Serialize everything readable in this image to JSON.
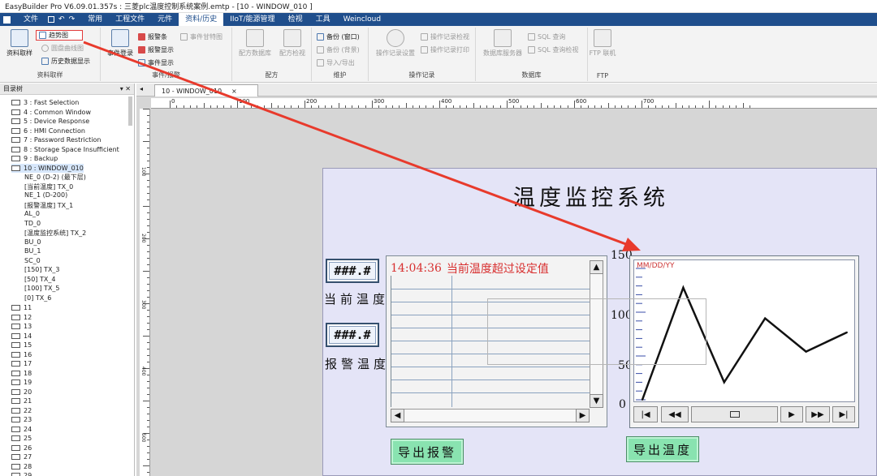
{
  "app": {
    "title": "EasyBuilder Pro V6.09.01.357s : 三菱plc温度控制系统案例.emtp - [10 - WINDOW_010 ]"
  },
  "menubar": {
    "items": [
      {
        "label": "文件"
      },
      {
        "label": "常用"
      },
      {
        "label": "工程文件"
      },
      {
        "label": "元件"
      },
      {
        "label": "资料/历史"
      },
      {
        "label": "IIoT/能源管理"
      },
      {
        "label": "检视"
      },
      {
        "label": "工具"
      },
      {
        "label": "Weincloud"
      }
    ],
    "active_index": 4
  },
  "ribbon": {
    "sample": {
      "big_label": "资料取样",
      "trend": "趋势图",
      "circle_trend": "圆盘曲线图",
      "history": "历史数据显示",
      "group": "资料取样"
    },
    "event": {
      "big_label": "事件登录",
      "alarm_bar": "报警条",
      "alarm_display": "报警显示",
      "event_display": "事件显示",
      "gantt": "事件甘特图",
      "group": "事件/报警"
    },
    "recipe": {
      "db": "配方数据库",
      "view": "配方检视",
      "group": "配方"
    },
    "maint": {
      "backup_win": "备份 (窗口)",
      "backup_bg": "备份 (背景)",
      "import_export": "导入/导出",
      "group": "维护"
    },
    "oplog": {
      "settings": "操作记录设置",
      "view": "操作记录检视",
      "print": "操作记录打印",
      "group": "操作记录"
    },
    "database": {
      "server": "数据库服务器",
      "sql_query": "SQL 查询",
      "sql_view": "SQL 查询检视",
      "group": "数据库"
    },
    "ftp": {
      "label": "FTP 联机",
      "group": "FTP"
    }
  },
  "panel": {
    "title": "目录树"
  },
  "tree": {
    "windows": [
      {
        "label": "3 : Fast Selection"
      },
      {
        "label": "4 : Common Window"
      },
      {
        "label": "5 : Device Response"
      },
      {
        "label": "6 : HMI Connection"
      },
      {
        "label": "7 : Password Restriction"
      },
      {
        "label": "8 : Storage Space Insufficient"
      },
      {
        "label": "9 : Backup"
      },
      {
        "label": "10 : WINDOW_010"
      }
    ],
    "objects": [
      {
        "label": "NE_0 (D-2) (最下层)"
      },
      {
        "label": "[当前温度] TX_0"
      },
      {
        "label": "NE_1 (D-200)"
      },
      {
        "label": "[报警温度] TX_1"
      },
      {
        "label": "AL_0"
      },
      {
        "label": "TD_0"
      },
      {
        "label": "[温度监控系统] TX_2"
      },
      {
        "label": "BU_0"
      },
      {
        "label": "BU_1"
      },
      {
        "label": "SC_0"
      },
      {
        "label": "[150] TX_3"
      },
      {
        "label": "[50] TX_4"
      },
      {
        "label": "[100] TX_5"
      },
      {
        "label": "[0] TX_6"
      }
    ],
    "numbers": [
      {
        "label": "11"
      },
      {
        "label": "12"
      },
      {
        "label": "13"
      },
      {
        "label": "14"
      },
      {
        "label": "15"
      },
      {
        "label": "16"
      },
      {
        "label": "17"
      },
      {
        "label": "18"
      },
      {
        "label": "19"
      },
      {
        "label": "20"
      },
      {
        "label": "21"
      },
      {
        "label": "22"
      },
      {
        "label": "23"
      },
      {
        "label": "24"
      },
      {
        "label": "25"
      },
      {
        "label": "26"
      },
      {
        "label": "27"
      },
      {
        "label": "28"
      },
      {
        "label": "29"
      }
    ]
  },
  "tab": {
    "label": "10 - WINDOW_010",
    "close": "×"
  },
  "ruler": {
    "ticks": [
      "0",
      "100",
      "200",
      "300",
      "400",
      "500",
      "600",
      "700"
    ],
    "vticks": [
      "100",
      "200",
      "300",
      "400",
      "500"
    ]
  },
  "screen": {
    "title": "温度监控系统",
    "current_temp": {
      "value": "###.#",
      "label": "当前温度"
    },
    "alarm_temp": {
      "value": "###.#",
      "label": "报警温度"
    },
    "alarm_list": {
      "time": "14:04:36",
      "message": "当前温度超过设定值"
    },
    "trend": {
      "date_format": "MM/DD/YY"
    },
    "export_alarm": "导出报警",
    "export_temp": "导出温度"
  },
  "chart_data": {
    "type": "line",
    "x": [
      0,
      1,
      2,
      3,
      4,
      5
    ],
    "series": [
      {
        "values": [
          0,
          128,
          20,
          93,
          55,
          77
        ]
      }
    ],
    "ytick_labels": [
      "150",
      "100",
      "50",
      "0"
    ],
    "ylim": [
      0,
      150
    ]
  }
}
